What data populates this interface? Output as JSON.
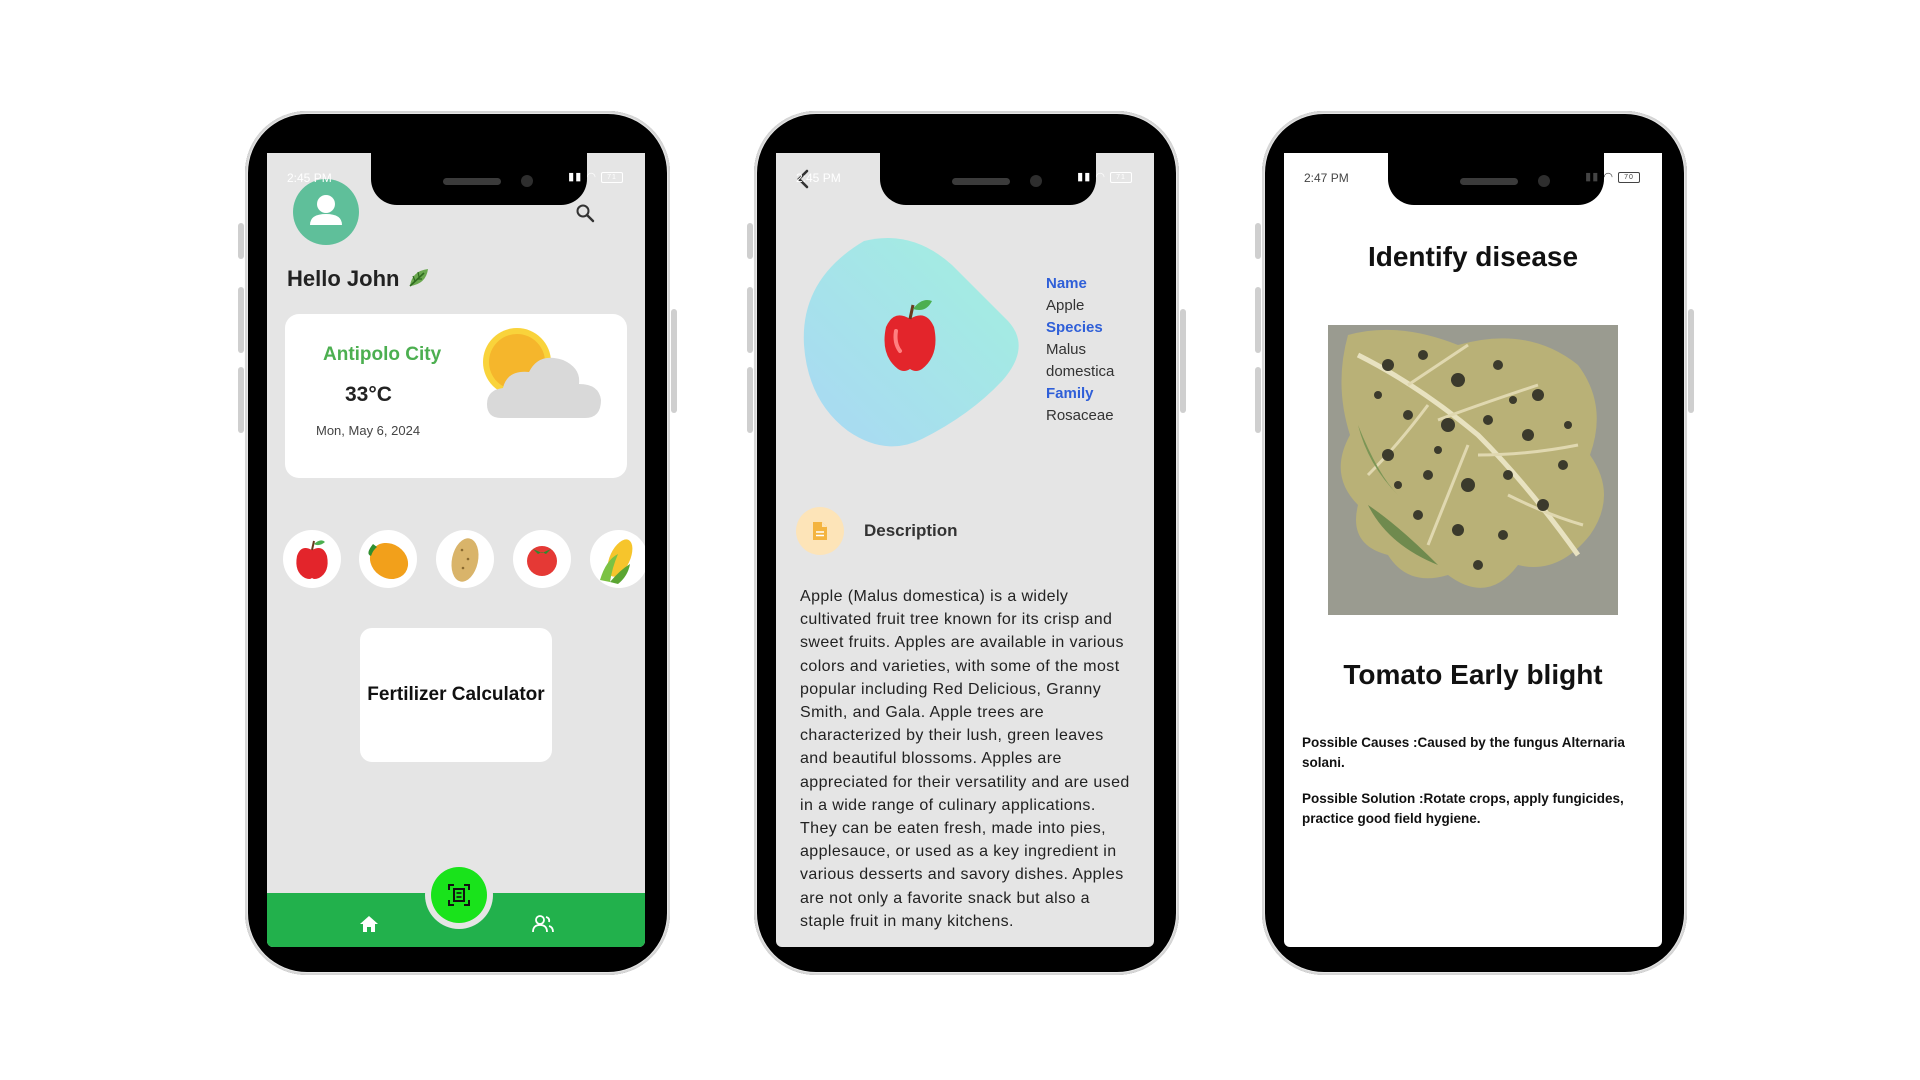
{
  "status_bar": [
    {
      "time": "2:45 PM",
      "battery": "71"
    },
    {
      "time": "2:45 PM",
      "battery": "71"
    },
    {
      "time": "2:47 PM",
      "battery": "70"
    }
  ],
  "home": {
    "greeting": "Hello John",
    "greeting_icon": "leaf-icon",
    "weather": {
      "city": "Antipolo City",
      "temperature": "33°C",
      "date": "Mon, May 6, 2024",
      "icon": "partly-cloudy-icon"
    },
    "crops": [
      "apple-icon",
      "mango-icon",
      "potato-icon",
      "tomato-icon",
      "corn-icon"
    ],
    "fertilizer_label": "Fertilizer Calculator",
    "nav": {
      "home_icon": "home-icon",
      "scan_icon": "scan-icon",
      "community_icon": "users-icon"
    },
    "colors": {
      "accent_green": "#22b14c",
      "fab_green": "#19e31b",
      "city_green": "#4caf50",
      "avatar": "#5fbf9a"
    }
  },
  "detail": {
    "name_label": "Name",
    "name_value": "Apple",
    "species_label": "Species",
    "species_value": "Malus domestica",
    "family_label": "Family",
    "family_value": "Rosaceae",
    "description_title": "Description",
    "description_text": "Apple (Malus domestica) is a widely cultivated fruit tree known for its crisp and sweet fruits. Apples are available in various colors and varieties, with some of the most popular including Red Delicious, Granny Smith, and Gala. Apple trees are characterized by their lush, green leaves and beautiful blossoms. Apples are appreciated for their versatility and are used in a wide range of culinary applications. They can be eaten fresh, made into pies, applesauce, or used as a key ingredient in various desserts and savory dishes. Apples are not only a favorite snack but also a staple fruit in many kitchens."
  },
  "disease": {
    "title": "Identify disease",
    "result": "Tomato Early blight",
    "causes": "Possible Causes :Caused by the fungus Alternaria solani.",
    "solution": "Possible Solution :Rotate crops, apply fungicides, practice good field hygiene."
  }
}
